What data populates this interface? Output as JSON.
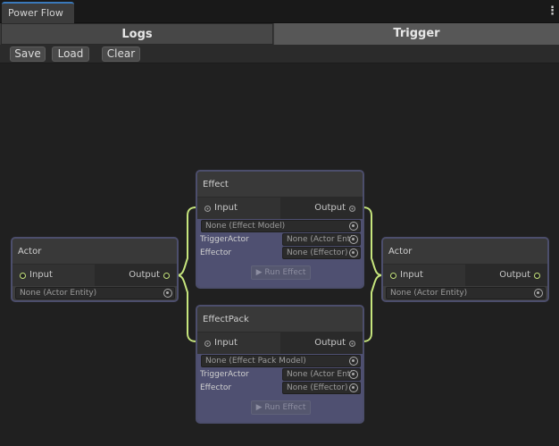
{
  "window": {
    "tab_title": "Power Flow",
    "menu_icon": "kebab-menu-icon"
  },
  "modes": {
    "logs": "Logs",
    "trigger": "Trigger"
  },
  "toolbar": {
    "save": "Save",
    "load": "Load",
    "clear": "Clear"
  },
  "colors": {
    "wire": "#c6e57d",
    "node_border": "#4c4e6c",
    "node_body": "#4f5071",
    "accent_tab": "#3a79bb"
  },
  "nodes": {
    "actor_left": {
      "title": "Actor",
      "input": "Input",
      "output": "Output",
      "entity": "None (Actor Entity)"
    },
    "effect": {
      "title": "Effect",
      "input": "Input",
      "output": "Output",
      "model": "None (Effect Model)",
      "trigger_actor_label": "TriggerActor",
      "trigger_actor_value": "None (Actor Entit",
      "effector_label": "Effector",
      "effector_value": "None (Effector)",
      "run": "▶ Run Effect"
    },
    "effect_pack": {
      "title": "EffectPack",
      "input": "Input",
      "output": "Output",
      "model": "None (Effect Pack Model)",
      "trigger_actor_label": "TriggerActor",
      "trigger_actor_value": "None (Actor Entit",
      "effector_label": "Effector",
      "effector_value": "None (Effector)",
      "run": "▶ Run Effect"
    },
    "actor_right": {
      "title": "Actor",
      "input": "Input",
      "output": "Output",
      "entity": "None (Actor Entity)"
    }
  }
}
